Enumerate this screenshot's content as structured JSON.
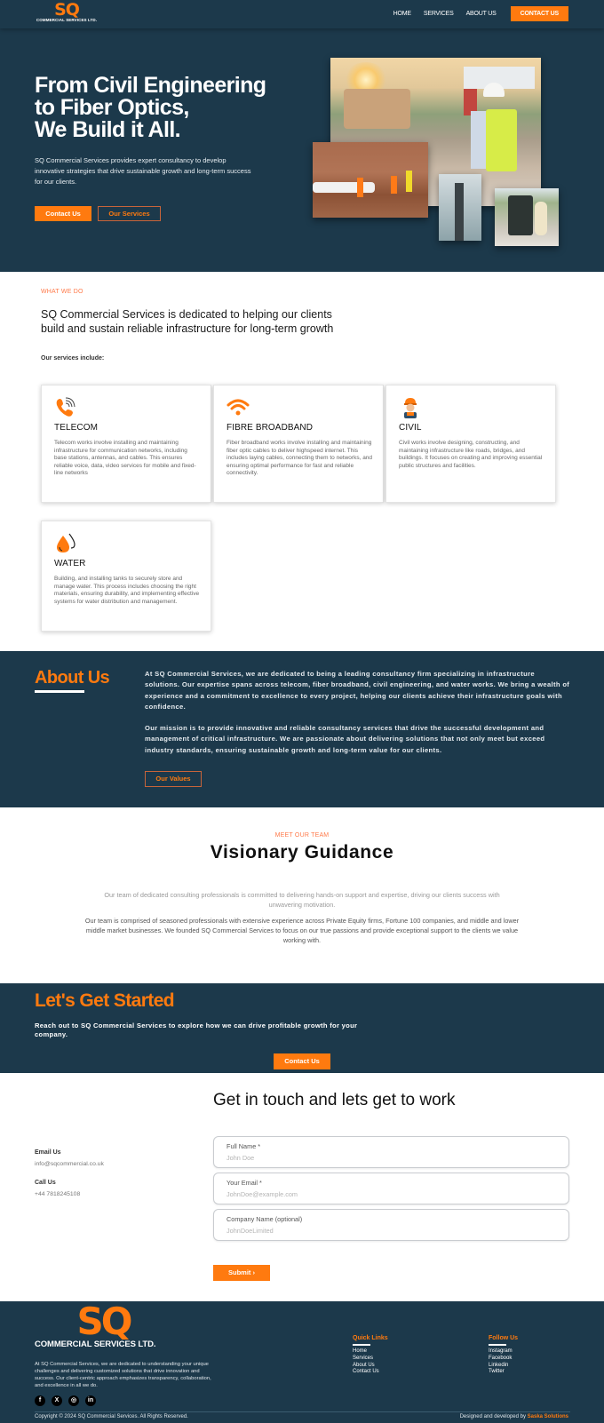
{
  "header": {
    "logo_main": "SQ",
    "logo_sub": "COMMERCIAL SERVICES LTD.",
    "nav": [
      "HOME",
      "SERVICES",
      "ABOUT US"
    ],
    "cta": "CONTACT US"
  },
  "hero": {
    "title_lines": [
      "From Civil Engineering",
      "to Fiber Optics,",
      "We Build it All."
    ],
    "description": "SQ Commercial Services provides expert consultancy to develop innovative strategies that drive sustainable growth and long-term success for our clients.",
    "primary_button": "Contact Us",
    "secondary_button": "Our Services",
    "images": [
      "surveyor-construction-site-photo",
      "fiber-cable-miniature-workers-photo",
      "telecom-tower-photo",
      "water-tank-photo"
    ]
  },
  "services": {
    "eyebrow": "WHAT WE DO",
    "heading": "SQ Commercial Services is dedicated to helping our clients build and sustain reliable infrastructure for long-term growth",
    "intro": "Our services include:",
    "cards": [
      {
        "icon": "phone-signal-icon",
        "title": "TELECOM",
        "text": "Telecom works involve installing and maintaining infrastructure for communication networks, including base stations, antennas, and cables. This ensures reliable voice, data, video services for mobile and fixed-line networks"
      },
      {
        "icon": "wifi-icon",
        "title": "FIBRE BROADBAND",
        "text": "Fiber broadband works involve installing and maintaining fiber optic cables to deliver highspeed internet. This includes laying cables, connecting them to networks, and ensuring optimal performance for fast and reliable connectivity."
      },
      {
        "icon": "construction-worker-icon",
        "title": "CIVIL",
        "text": "Civil works involve designing, constructing, and maintaining infrastructure like roads, bridges, and buildings. It focuses on creating and improving essential public structures and facilities."
      },
      {
        "icon": "water-drops-icon",
        "title": "WATER",
        "text": "Building, and installing tanks to securely store and manage water. This process includes choosing the right materials, ensuring durability, and implementing effective systems for water distribution and management."
      }
    ]
  },
  "about": {
    "title": "About Us",
    "p1": "At SQ Commercial Services, we are dedicated to being a leading consultancy firm specializing in infrastructure solutions. Our expertise spans across telecom, fiber broadband, civil engineering, and water works. We bring a wealth of experience and a commitment to excellence to every project, helping our clients achieve their infrastructure goals with confidence.",
    "p2": "Our mission is to provide innovative and reliable consultancy services that drive the successful development and management of critical infrastructure. We are passionate about delivering solutions that not only meet but exceed industry standards, ensuring sustainable growth and long-term value for our clients.",
    "button": "Our Values"
  },
  "team": {
    "eyebrow": "MEET OUR TEAM",
    "title": "Visionary Guidance",
    "lead": "Our team of dedicated consulting professionals is committed to delivering hands-on support and expertise, driving our clients success with unwavering motivation.",
    "body": "Our team is comprised of seasoned professionals with extensive experience across Private Equity firms, Fortune 100 companies, and middle and lower middle market businesses. We founded SQ Commercial Services to focus on our true passions and provide exceptional support to the clients we value working with."
  },
  "cta": {
    "title": "Let's Get Started",
    "text": "Reach out to SQ Commercial Services to explore how we can drive profitable growth for your company.",
    "button": "Contact Us"
  },
  "contact": {
    "title": "Get in touch and lets get to work",
    "email_label": "Email Us",
    "email": "info@sqcommercial.co.uk",
    "phone_label": "Call Us",
    "phone": "+44 7818245108",
    "fields": [
      {
        "label": "Full Name *",
        "placeholder": "John Doe",
        "value": ""
      },
      {
        "label": "Your Email *",
        "placeholder": "JohnDoe@example.com",
        "value": ""
      },
      {
        "label": "Company Name (optional)",
        "placeholder": "JohnDoeLimited",
        "value": ""
      }
    ],
    "submit": "Submit ›"
  },
  "footer": {
    "logo_main": "SQ",
    "logo_sub": "COMMERCIAL SERVICES LTD.",
    "description": "At SQ Commercial Services, we are dedicated to understanding your unique challenges and delivering customized solutions that drive innovation and success. Our client-centric approach emphasizes transparency, collaboration, and excellence in all we do.",
    "social_icons": [
      "f",
      "X",
      "◎",
      "in"
    ],
    "quick_links_title": "Quick Links",
    "quick_links": [
      "Home",
      "Services",
      "About Us",
      "Contact Us"
    ],
    "follow_title": "Follow Us",
    "follow_links": [
      "Instagram",
      "Facebook",
      "Linkedin",
      "Twitter"
    ],
    "copyright": "Copyright © 2024 SQ Commercial Services. All Rights Reserved.",
    "credit_prefix": "Designed and developed by",
    "credit_name": "Saska Solutions"
  },
  "colors": {
    "navy": "#1c394b",
    "accent": "#ff7a0f"
  }
}
